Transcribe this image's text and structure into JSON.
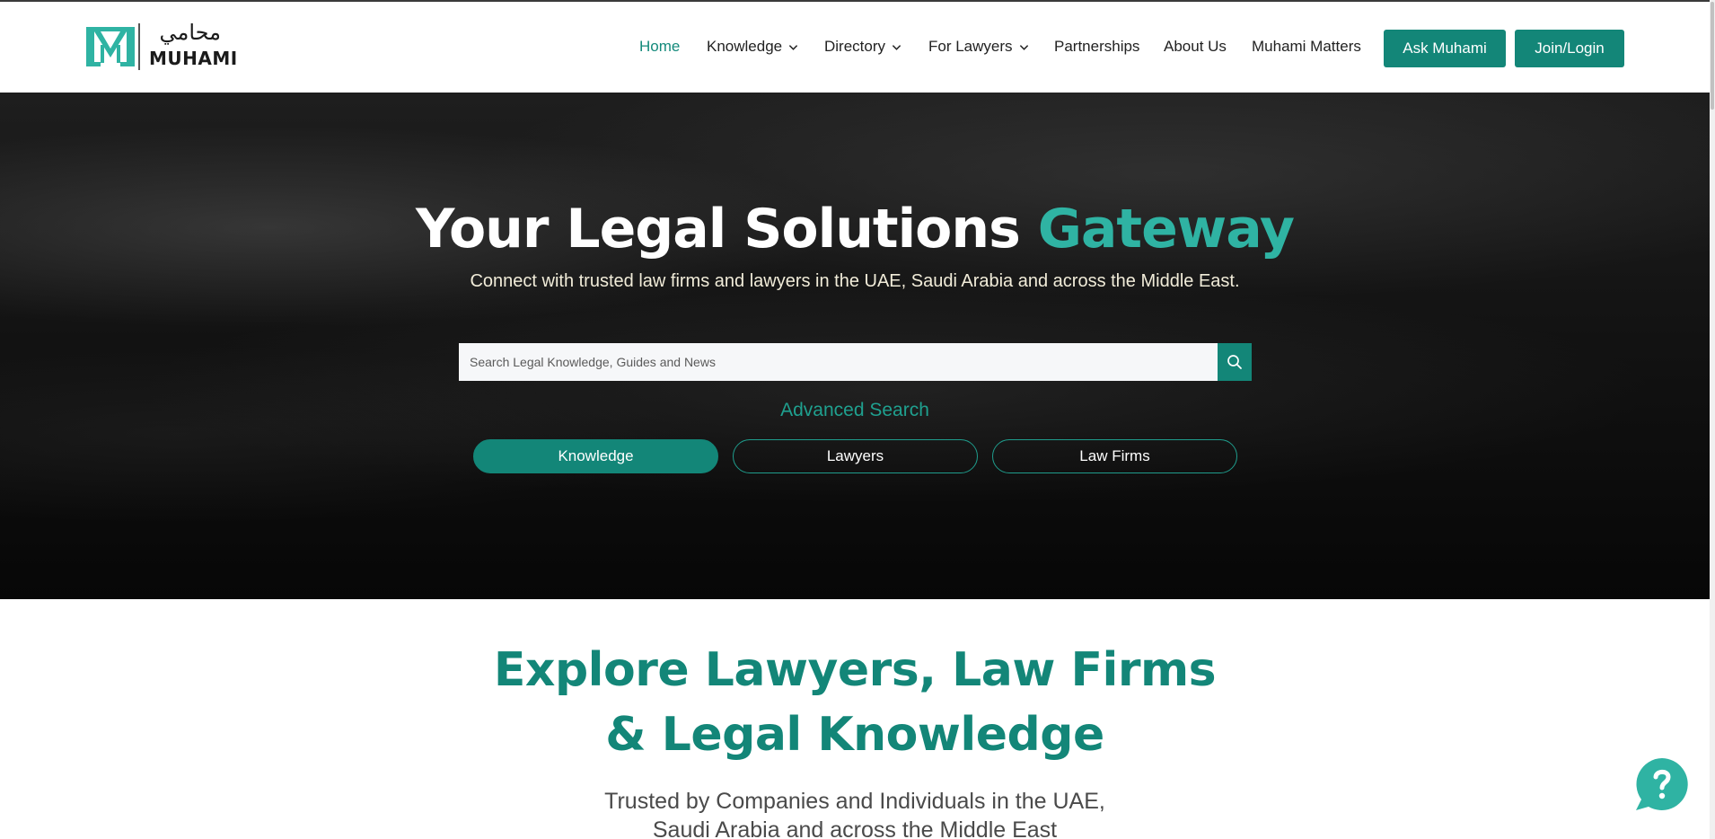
{
  "brand": {
    "name_ar": "محامي",
    "name_en": "MUHAMI"
  },
  "nav": {
    "items": [
      {
        "label": "Home",
        "active": true,
        "dropdown": false
      },
      {
        "label": "Knowledge",
        "active": false,
        "dropdown": true
      },
      {
        "label": "Directory",
        "active": false,
        "dropdown": true
      },
      {
        "label": "For Lawyers",
        "active": false,
        "dropdown": true
      },
      {
        "label": "Partnerships",
        "active": false,
        "dropdown": false
      },
      {
        "label": "About Us",
        "active": false,
        "dropdown": false
      },
      {
        "label": "Muhami Matters",
        "active": false,
        "dropdown": false
      }
    ],
    "ask_label": "Ask Muhami",
    "join_label": "Join/Login"
  },
  "hero": {
    "title_main": "Your Legal Solutions ",
    "title_accent": "Gateway",
    "subtitle": "Connect with trusted law firms and lawyers in the UAE, Saudi Arabia and across the Middle East.",
    "search_placeholder": "Search Legal Knowledge, Guides and News",
    "search_icon": "search-icon",
    "advanced_search": "Advanced Search",
    "tabs": [
      {
        "label": "Knowledge",
        "active": true
      },
      {
        "label": "Lawyers",
        "active": false
      },
      {
        "label": "Law Firms",
        "active": false
      }
    ]
  },
  "explore": {
    "title_line1": "Explore Lawyers, Law Firms",
    "title_line2": "& Legal Knowledge",
    "subtitle": "Trusted by Companies and Individuals in the UAE, Saudi Arabia and across the Middle East"
  },
  "help_icon": "question-chat-icon",
  "colors": {
    "brand_teal": "#138678",
    "accent_teal": "#2fb3a3",
    "hero_dark": "#121212"
  }
}
